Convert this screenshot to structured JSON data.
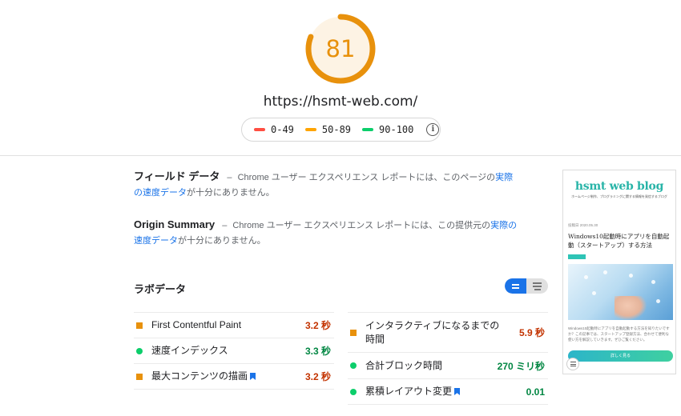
{
  "score": {
    "value": "81",
    "fraction": 0.81,
    "color": "#e8910c",
    "track_color": "#fdf3e4"
  },
  "url": "https://hsmt-web.com/",
  "legend": {
    "items": [
      {
        "label": "0-49",
        "color": "#ff4e42"
      },
      {
        "label": "50-89",
        "color": "#ffa400"
      },
      {
        "label": "90-100",
        "color": "#0cce6b"
      }
    ],
    "info_icon": "info-icon"
  },
  "field_data": {
    "title": "フィールド データ",
    "dash": "–",
    "text_before": "Chrome ユーザー エクスペリエンス レポートには、このページの",
    "link": "実際の速度データ",
    "text_after": "が十分にありません。"
  },
  "origin_summary": {
    "title": "Origin Summary",
    "dash": "–",
    "text_before": "Chrome ユーザー エクスペリエンス レポートには、この提供元の",
    "link": "実際の速度データ",
    "text_after": "が十分にありません。"
  },
  "lab_data": {
    "title": "ラボデータ",
    "left_metrics": [
      {
        "label": "First Contentful Paint",
        "value": "3.2 秒",
        "status": "average",
        "bookmark": false
      },
      {
        "label": "速度インデックス",
        "value": "3.3 秒",
        "status": "pass",
        "bookmark": false
      },
      {
        "label": "最大コンテンツの描画",
        "value": "3.2 秒",
        "status": "average",
        "bookmark": true
      }
    ],
    "right_metrics": [
      {
        "label": "インタラクティブになるまでの時間",
        "value": "5.9 秒",
        "status": "average",
        "bookmark": false
      },
      {
        "label": "合計ブロック時間",
        "value": "270 ミリ秒",
        "status": "pass",
        "bookmark": false
      },
      {
        "label": "累積レイアウト変更",
        "value": "0.01",
        "status": "pass",
        "bookmark": true
      }
    ],
    "colors": {
      "average": "#c33300",
      "pass": "#018642"
    }
  },
  "thumbnail": {
    "logo": "hsmt web blog",
    "subtitle": "ホームページ制作、プログラミングに関する情報を発信するブログ",
    "date": "投稿日 2020.05.30",
    "title": "Windows10起動時にアプリを自動起動（スタートアップ）する方法",
    "body": "Windows10起動時にアプリを自動起動する方法を知りたいですか？この記事では、スタートアップ登録方法、合わせて便利な使い方を解説していきます。ぜひご覧ください。",
    "button": "詳しく見る"
  }
}
